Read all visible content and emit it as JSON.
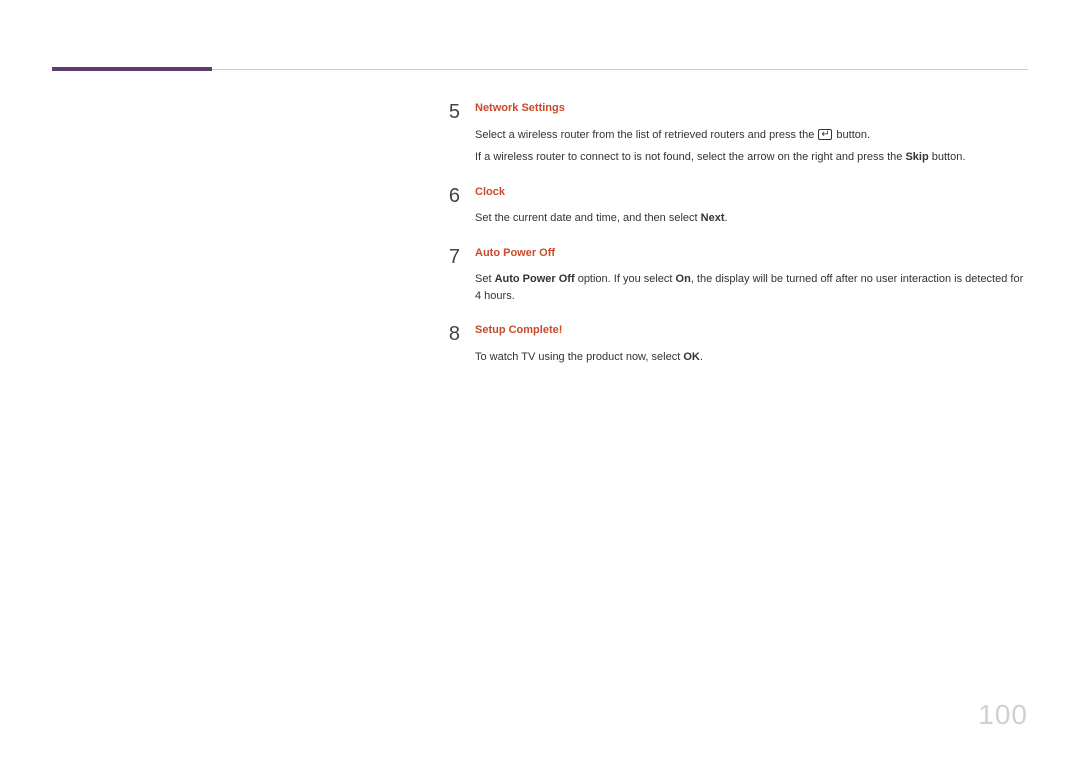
{
  "page_number": "100",
  "steps": [
    {
      "number": "5",
      "title": "Network Settings",
      "text_parts": [
        {
          "type": "line",
          "segments": [
            {
              "text": "Select a wireless router from the list of retrieved routers and press the "
            },
            {
              "icon": "enter"
            },
            {
              "text": " button."
            }
          ]
        },
        {
          "type": "line",
          "segments": [
            {
              "text": "If a wireless router to connect to is not found, select the arrow on the right and press the "
            },
            {
              "bold": true,
              "text": "Skip"
            },
            {
              "text": " button."
            }
          ]
        }
      ]
    },
    {
      "number": "6",
      "title": "Clock",
      "text_parts": [
        {
          "type": "line",
          "segments": [
            {
              "text": "Set the current date and time, and then select "
            },
            {
              "bold": true,
              "text": "Next"
            },
            {
              "text": "."
            }
          ]
        }
      ]
    },
    {
      "number": "7",
      "title": "Auto Power Off",
      "text_parts": [
        {
          "type": "line",
          "segments": [
            {
              "text": "Set "
            },
            {
              "bold": true,
              "text": "Auto Power Off"
            },
            {
              "text": " option. If you select "
            },
            {
              "bold": true,
              "text": "On"
            },
            {
              "text": ", the display will be turned off after no user interaction is detected for 4 hours."
            }
          ]
        }
      ]
    },
    {
      "number": "8",
      "title": "Setup Complete!",
      "text_parts": [
        {
          "type": "line",
          "segments": [
            {
              "text": "To watch TV using the product now, select "
            },
            {
              "bold": true,
              "text": "OK"
            },
            {
              "text": "."
            }
          ]
        }
      ]
    }
  ]
}
